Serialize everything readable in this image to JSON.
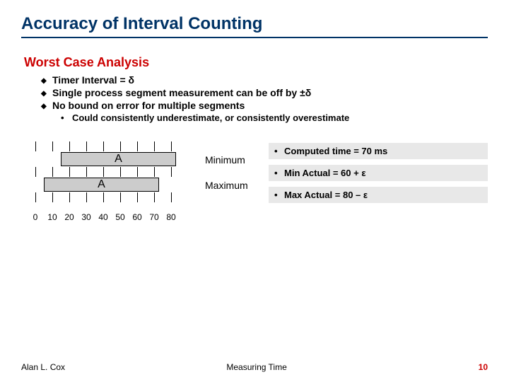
{
  "title": "Accuracy of Interval Counting",
  "subtitle": "Worst Case Analysis",
  "bullets": [
    "Timer Interval = δ",
    "Single process segment measurement can be off by ±δ",
    "No bound on error for multiple segments"
  ],
  "subbullet": "Could consistently underestimate, or consistently overestimate",
  "bar_label": "A",
  "min_label": "Minimum",
  "max_label": "Maximum",
  "axis": [
    "0",
    "10",
    "20",
    "30",
    "40",
    "50",
    "60",
    "70",
    "80"
  ],
  "facts": [
    "Computed time = 70 ms",
    "Min Actual = 60 + ε",
    "Max Actual = 80 – ε"
  ],
  "footer": {
    "left": "Alan L. Cox",
    "mid": "Measuring Time",
    "page": "10"
  }
}
